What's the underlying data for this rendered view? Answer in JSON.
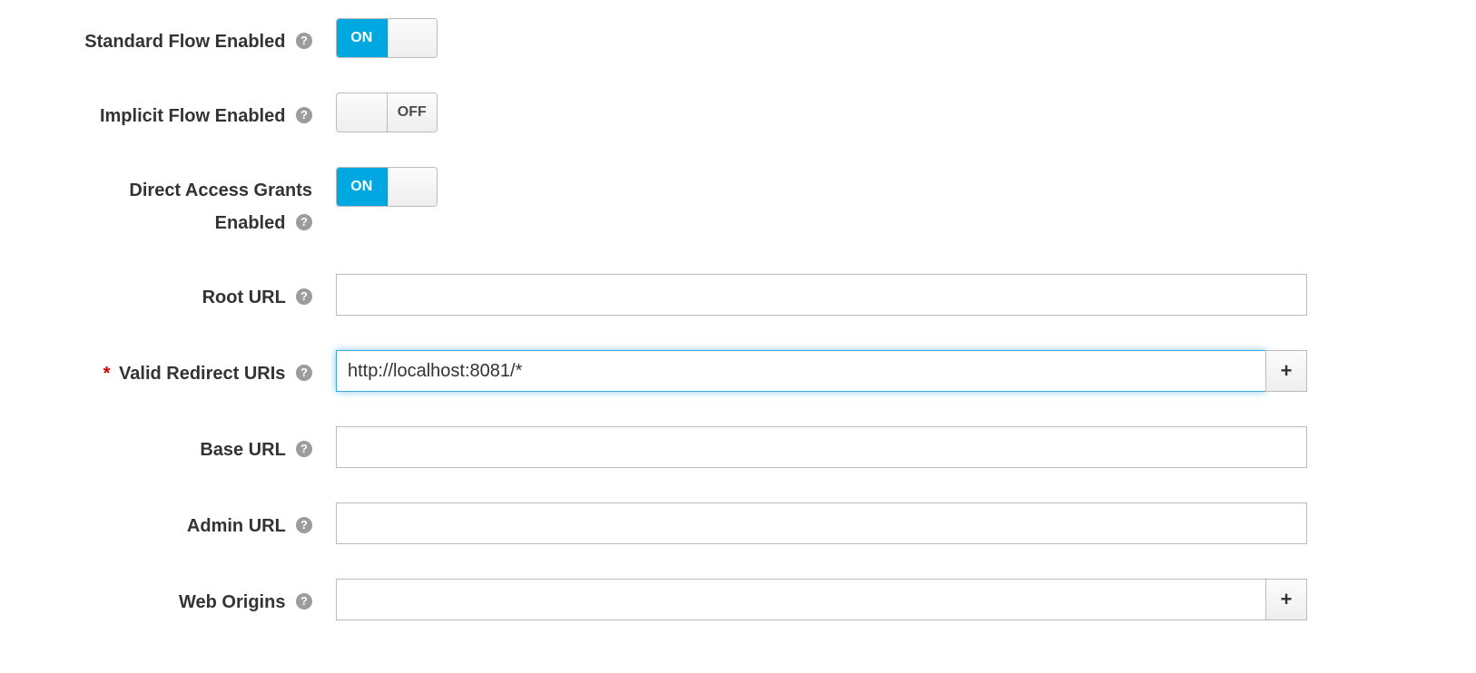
{
  "fields": {
    "standardFlow": {
      "label": "Standard Flow Enabled",
      "value": "ON"
    },
    "implicitFlow": {
      "label": "Implicit Flow Enabled",
      "value": "OFF"
    },
    "directAccess": {
      "label": "Direct Access Grants Enabled",
      "value": "ON"
    },
    "rootUrl": {
      "label": "Root URL",
      "value": ""
    },
    "validRedirect": {
      "label": "Valid Redirect URIs",
      "value": "http://localhost:8081/*",
      "required": true
    },
    "baseUrl": {
      "label": "Base URL",
      "value": ""
    },
    "adminUrl": {
      "label": "Admin URL",
      "value": ""
    },
    "webOrigins": {
      "label": "Web Origins",
      "value": ""
    }
  },
  "toggle": {
    "on": "ON",
    "off": "OFF"
  },
  "buttons": {
    "add": "+"
  }
}
